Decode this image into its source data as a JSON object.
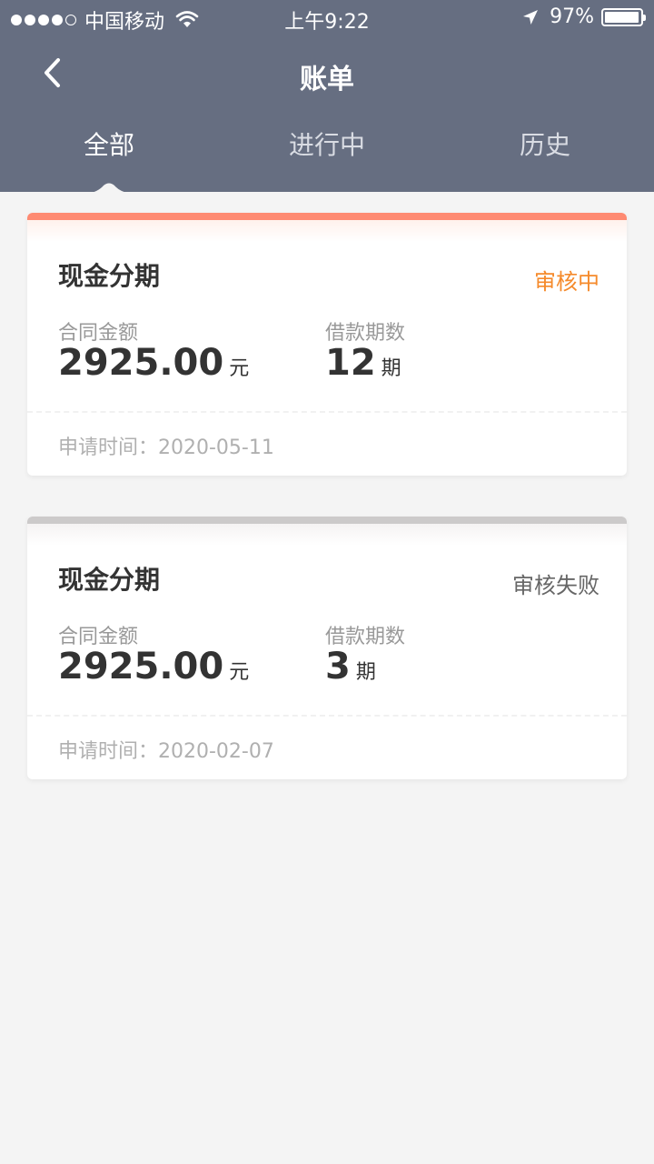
{
  "statusbar": {
    "carrier": "中国移动",
    "time": "上午9:22",
    "battery": "97%",
    "battery_level": 0.97
  },
  "nav": {
    "title": "账单"
  },
  "tabs": [
    {
      "label": "全部"
    },
    {
      "label": "进行中"
    },
    {
      "label": "历史"
    }
  ],
  "cards": [
    {
      "title": "现金分期",
      "status": "审核中",
      "amount_label": "合同金额",
      "amount": "2925.00",
      "amount_unit": "元",
      "term_label": "借款期数",
      "term": "12",
      "term_unit": "期",
      "date_text": "申请时间：2020-05-11"
    },
    {
      "title": "现金分期",
      "status": "审核失败",
      "amount_label": "合同金额",
      "amount": "2925.00",
      "amount_unit": "元",
      "term_label": "借款期数",
      "term": "3",
      "term_unit": "期",
      "date_text": "申请时间：2020-02-07"
    }
  ],
  "colors": {
    "header": "#666e81",
    "status_pending": "#f58a2b",
    "status_failed": "#666666",
    "accent_pending": "#fe8a72",
    "accent_failed": "#cccaca"
  }
}
